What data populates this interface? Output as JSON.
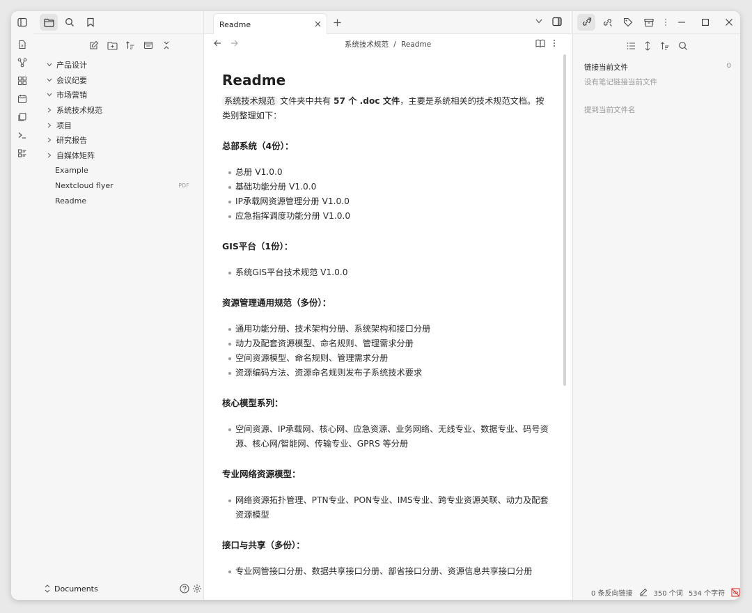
{
  "explorer": {
    "items": [
      {
        "label": "产品设计",
        "type": "folder"
      },
      {
        "label": "会议纪要",
        "type": "folder"
      },
      {
        "label": "市场营销",
        "type": "folder"
      },
      {
        "label": "系统技术规范",
        "type": "folder-collapsed"
      },
      {
        "label": "项目",
        "type": "folder-collapsed"
      },
      {
        "label": "研究报告",
        "type": "folder-collapsed"
      },
      {
        "label": "自媒体矩阵",
        "type": "folder-collapsed"
      },
      {
        "label": "Example",
        "type": "file"
      },
      {
        "label": "Nextcloud flyer",
        "type": "file",
        "tag": "PDF"
      },
      {
        "label": "Readme",
        "type": "file"
      }
    ],
    "vault_name": "Documents"
  },
  "tab": {
    "label": "Readme"
  },
  "breadcrumb": {
    "folder": "系统技术规范",
    "separator": "/",
    "file": "Readme"
  },
  "note": {
    "title": "Readme",
    "intro": {
      "folder": "系统技术规范",
      "mid": " 文件夹中共有 ",
      "count": "57 个 .doc 文件",
      "tail": "，主要是系统相关的技术规范文档。按类别整理如下："
    },
    "sections": [
      {
        "heading": "总部系统（4份）：",
        "items": [
          "总册 V1.0.0",
          "基础功能分册 V1.0.0",
          "IP承载网资源管理分册 V1.0.0",
          "应急指挥调度功能分册 V1.0.0"
        ]
      },
      {
        "heading": "GIS平台（1份）：",
        "items": [
          "系统GIS平台技术规范 V1.0.0"
        ]
      },
      {
        "heading": "资源管理通用规范（多份）：",
        "items": [
          "通用功能分册、技术架构分册、系统架构和接口分册",
          "动力及配套资源模型、命名规则、管理需求分册",
          "空间资源模型、命名规则、管理需求分册",
          "资源编码方法、资源命名规则发布子系统技术要求"
        ]
      },
      {
        "heading": "核心模型系列：",
        "items": [
          "空间资源、IP承载网、核心网、应急资源、业务网络、无线专业、数据专业、码号资源、核心网/智能网、传输专业、GPRS 等分册"
        ]
      },
      {
        "heading": "专业网络资源模型：",
        "items": [
          "网络资源拓扑管理、PTN专业、PON专业、IMS专业、跨专业资源关联、动力及配套资源模型"
        ]
      },
      {
        "heading": "接口与共享（多份）：",
        "items": [
          "专业网管接口分册、数据共享接口分册、部省接口分册、资源信息共享接口分册"
        ]
      }
    ]
  },
  "backlinks": {
    "linked_title": "链接当前文件",
    "linked_count": "0",
    "linked_empty": "没有笔记链接当前文件",
    "unlinked_title": "提到当前文件名"
  },
  "status": {
    "backlinks": "0 条反向链接",
    "words": "350 个词",
    "chars": "534 个字符"
  }
}
